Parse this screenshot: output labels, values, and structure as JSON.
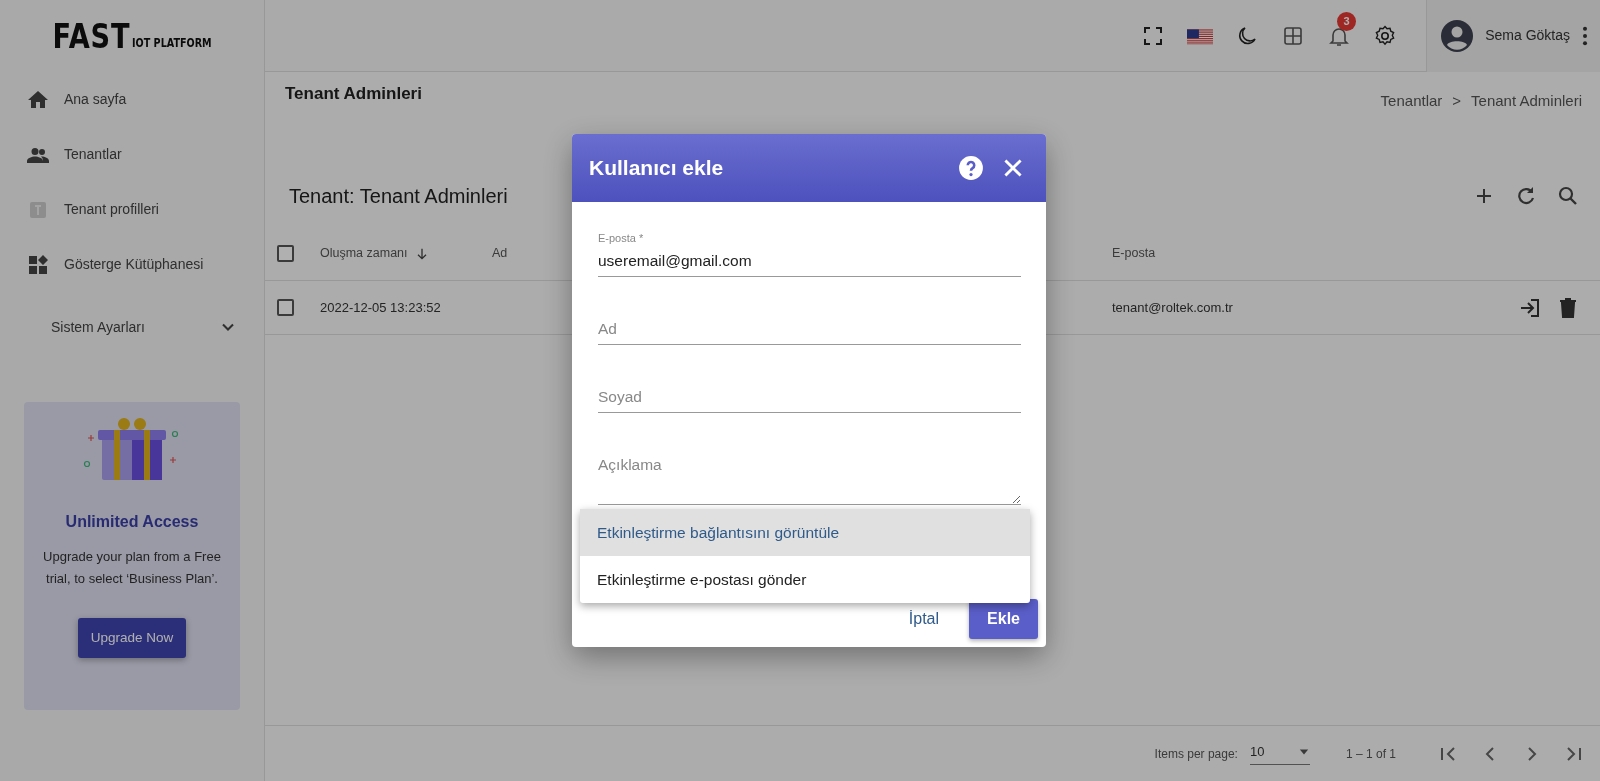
{
  "logo": {
    "main": "FAST",
    "sub": "IOT PLATFORM"
  },
  "sidebar": {
    "items": [
      {
        "label": "Ana sayfa"
      },
      {
        "label": "Tenantlar"
      },
      {
        "label": "Tenant profilleri"
      },
      {
        "label": "Gösterge Kütüphanesi"
      }
    ],
    "section": {
      "label": "Sistem Ayarları",
      "expanded": false
    },
    "promo": {
      "title": "Unlimited Access",
      "text": "Upgrade your plan from a Free trial, to select ‘Business Plan’.",
      "button": "Upgrade Now"
    }
  },
  "topbar": {
    "notifications": "3",
    "user": "Sema Göktaş"
  },
  "page": {
    "title": "Tenant Adminleri",
    "breadcrumb": {
      "items": [
        "Tenantlar",
        "Tenant Adminleri"
      ],
      "separator": ">"
    }
  },
  "table": {
    "title": "Tenant: Tenant Adminleri",
    "all_checked": false,
    "columns": [
      {
        "label": "Oluşma zamanı",
        "sorted": true
      },
      {
        "label": "Ad",
        "sorted": false
      },
      {
        "label": "E-posta",
        "sorted": false
      }
    ],
    "rows": [
      {
        "checked": false,
        "created": "2022-12-05 13:23:52",
        "email": "tenant@roltek.com.tr"
      }
    ]
  },
  "paginator": {
    "label": "Items per page:",
    "page_size": "10",
    "range": "1 – 1 of 1"
  },
  "dialog": {
    "title": "Kullanıcı ekle",
    "fields": [
      {
        "kind": "input",
        "label": "E-posta *",
        "value": "useremail@gmail.com"
      },
      {
        "kind": "input",
        "placeholder": "Ad"
      },
      {
        "kind": "input",
        "placeholder": "Soyad"
      },
      {
        "kind": "textarea",
        "placeholder": "Açıklama"
      }
    ],
    "options": [
      {
        "label": "Etkinleştirme bağlantısını görüntüle",
        "selected": true
      },
      {
        "label": "Etkinleştirme e-postası gönder",
        "selected": false
      }
    ],
    "buttons": [
      {
        "kind": "text",
        "label": "İptal"
      },
      {
        "kind": "primary",
        "label": "Ekle"
      }
    ]
  }
}
